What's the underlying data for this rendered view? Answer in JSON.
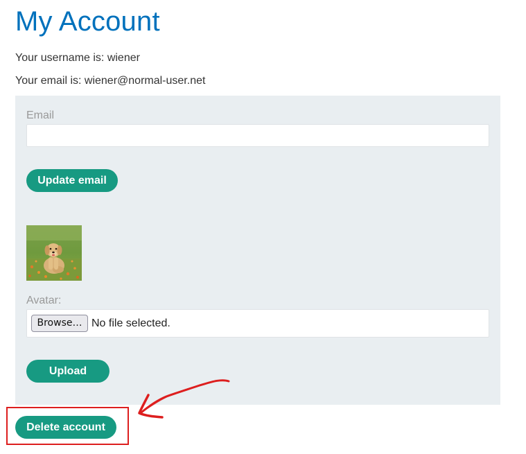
{
  "page": {
    "title": "My Account",
    "username_line": "Your username is: wiener",
    "email_line": "Your email is: wiener@normal-user.net"
  },
  "form": {
    "email_label": "Email",
    "email_value": "",
    "update_button": "Update email",
    "avatar_label": "Avatar:",
    "browse_button": "Browse…",
    "file_status": "No file selected.",
    "upload_button": "Upload"
  },
  "delete_button": "Delete account",
  "colors": {
    "title": "#0071bc",
    "button": "#179a82",
    "panel": "#e9eef1",
    "annotation": "#dd1e1e"
  },
  "icons": {
    "avatar": "dog-avatar-image",
    "annotation_arrow": "red-arrow-annotation"
  }
}
